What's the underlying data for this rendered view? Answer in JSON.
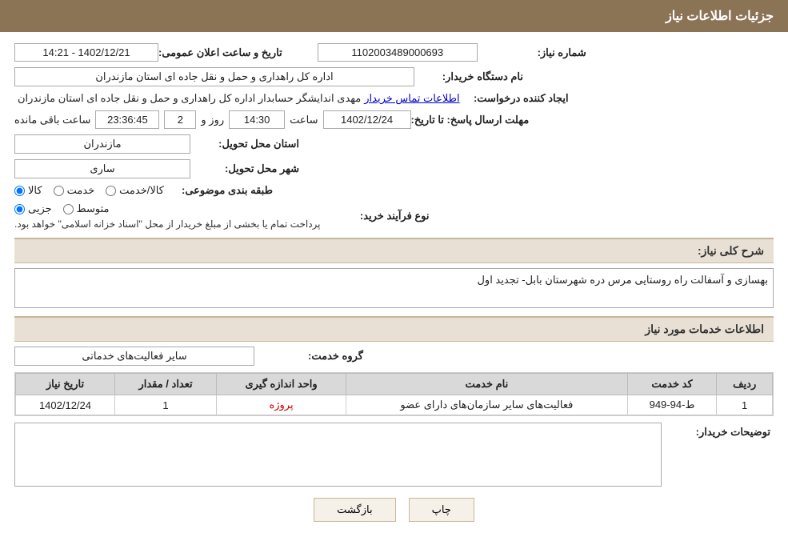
{
  "header": {
    "title": "جزئیات اطلاعات نیاز"
  },
  "fields": {
    "need_number_label": "شماره نیاز:",
    "need_number_value": "1102003489000693",
    "datetime_label": "تاریخ و ساعت اعلان عمومی:",
    "datetime_value": "1402/12/21 - 14:21",
    "buyer_org_label": "نام دستگاه خریدار:",
    "buyer_org_value": "اداره کل راهداری و حمل و نقل جاده ای استان مازندران",
    "creator_label": "ایجاد کننده درخواست:",
    "creator_value": "مهدی اندایشگر حسابدار اداره کل راهداری و حمل و نقل جاده ای استان مازندران",
    "creator_link": "اطلاعات تماس خریدار",
    "answer_deadline_label": "مهلت ارسال پاسخ: تا تاریخ:",
    "answer_date": "1402/12/24",
    "answer_time_label": "ساعت",
    "answer_time": "14:30",
    "answer_days_label": "روز و",
    "answer_days": "2",
    "remaining_time_label": "ساعت باقی مانده",
    "remaining_time": "23:36:45",
    "delivery_province_label": "استان محل تحویل:",
    "delivery_province": "مازندران",
    "delivery_city_label": "شهر محل تحویل:",
    "delivery_city": "ساری",
    "subject_label": "طبقه بندی موضوعی:",
    "subject_options": [
      {
        "label": "کالا",
        "selected": false
      },
      {
        "label": "خدمت",
        "selected": false
      },
      {
        "label": "کالا/خدمت",
        "selected": false
      }
    ],
    "purchase_type_label": "نوع فرآیند خرید:",
    "purchase_options": [
      {
        "label": "جزیی",
        "selected": false
      },
      {
        "label": "متوسط",
        "selected": false
      }
    ],
    "purchase_notice": "پرداخت تمام یا بخشی از مبلغ خریدار از محل \"اسناد خزانه اسلامی\" خواهد بود.",
    "general_desc_label": "شرح کلی نیاز:",
    "general_desc_value": "بهسازی و آسفالت راه روستایی مرس دره شهرستان بابل- تجدید اول",
    "services_section": "اطلاعات خدمات مورد نیاز",
    "service_group_label": "گروه خدمت:",
    "service_group_value": "سایر فعالیت‌های خدماتی",
    "table": {
      "headers": [
        "ردیف",
        "کد خدمت",
        "نام خدمت",
        "واحد اندازه گیری",
        "تعداد / مقدار",
        "تاریخ نیاز"
      ],
      "rows": [
        {
          "row": "1",
          "code": "ط-94-949",
          "name": "فعالیت‌های سایر سازمان‌های دارای عضو",
          "unit": "پروژه",
          "qty": "1",
          "date": "1402/12/24"
        }
      ]
    },
    "buyer_desc_label": "توضیحات خریدار:",
    "buyer_desc_value": ""
  },
  "buttons": {
    "back_label": "بازگشت",
    "print_label": "چاپ"
  }
}
